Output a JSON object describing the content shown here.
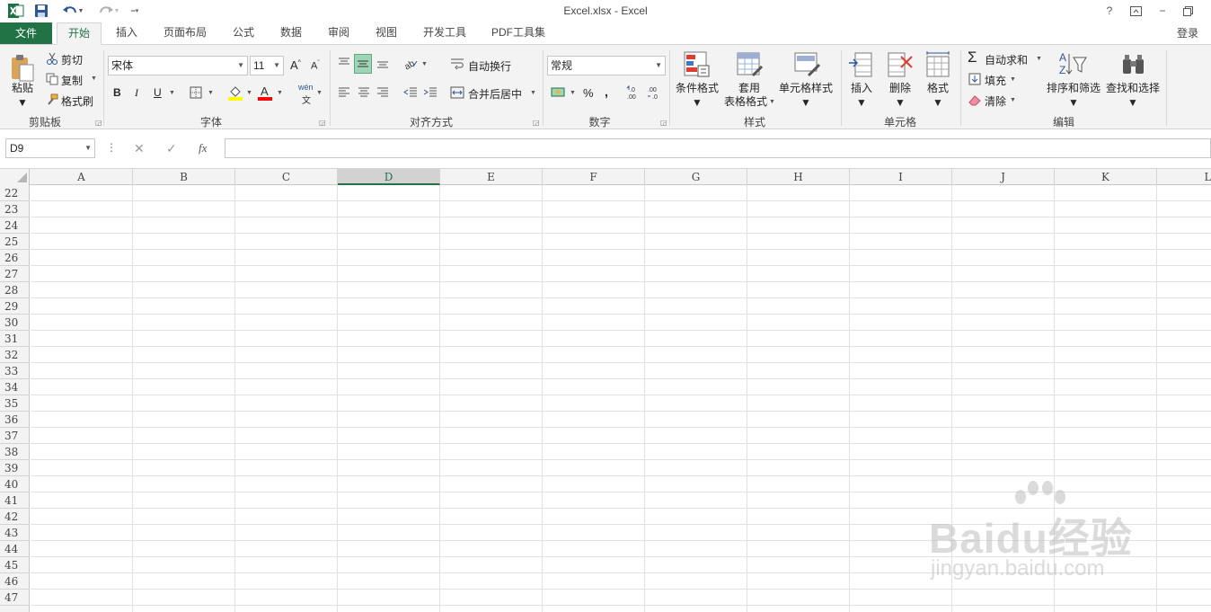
{
  "window": {
    "title": "Excel.xlsx - Excel",
    "help": "?",
    "minimize": "−",
    "restore": "🗗",
    "close": "✕"
  },
  "tabs": {
    "file": "文件",
    "home": "开始",
    "insert": "插入",
    "page_layout": "页面布局",
    "formulas": "公式",
    "data": "数据",
    "review": "审阅",
    "view": "视图",
    "developer": "开发工具",
    "pdf": "PDF工具集",
    "login": "登录"
  },
  "ribbon": {
    "clipboard": {
      "paste": "粘贴",
      "cut": "剪切",
      "copy": "复制",
      "format_painter": "格式刷",
      "label": "剪贴板"
    },
    "font": {
      "font_name": "宋体",
      "font_size": "11",
      "bold": "B",
      "italic": "I",
      "underline": "U",
      "phonetic": "wén",
      "label": "字体"
    },
    "alignment": {
      "wrap": "自动换行",
      "merge": "合并后居中",
      "label": "对齐方式"
    },
    "number": {
      "format": "常规",
      "percent": "%",
      "comma": ",",
      "label": "数字"
    },
    "styles": {
      "conditional": "条件格式",
      "table_line1": "套用",
      "table_line2": "表格格式",
      "cell_styles": "单元格样式",
      "label": "样式"
    },
    "cells": {
      "insert": "插入",
      "delete": "删除",
      "format": "格式",
      "label": "单元格"
    },
    "editing": {
      "autosum": "自动求和",
      "fill": "填充",
      "clear": "清除",
      "sort": "排序和筛选",
      "find": "查找和选择",
      "label": "编辑"
    }
  },
  "formula_bar": {
    "name_box": "D9",
    "formula": "",
    "fx": "fx"
  },
  "sheet": {
    "columns": [
      "A",
      "B",
      "C",
      "D",
      "E",
      "F",
      "G",
      "H",
      "I",
      "J",
      "K",
      "L"
    ],
    "selected_column": "D",
    "rows": [
      "22",
      "23",
      "24",
      "25",
      "26",
      "27",
      "28",
      "29",
      "30",
      "31",
      "32",
      "33",
      "34",
      "35",
      "36",
      "37",
      "38",
      "39",
      "40",
      "41",
      "42",
      "43",
      "44",
      "45",
      "46",
      "47"
    ]
  },
  "watermark": {
    "main": "Baidu经验",
    "sub": "jingyan.baidu.com"
  },
  "colors": {
    "excel_green": "#217346",
    "ribbon_bg": "#f3f3f3",
    "grid_line": "#e1e1e1"
  }
}
